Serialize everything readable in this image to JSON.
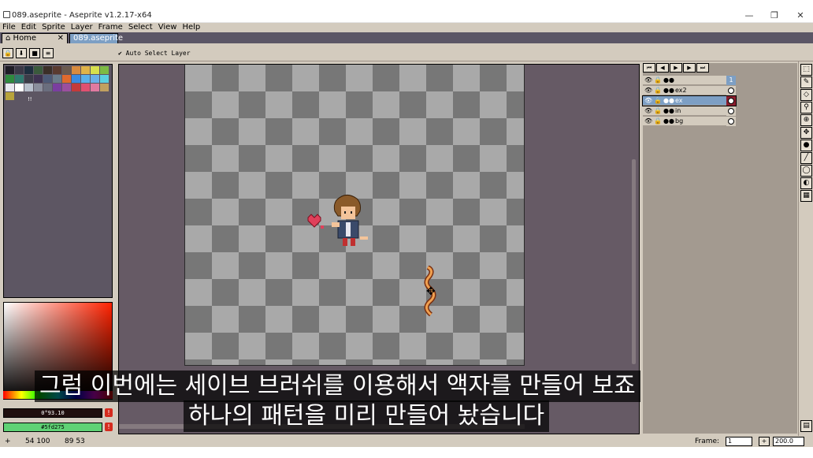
{
  "window": {
    "title": "089.aseprite - Aseprite v1.2.17-x64",
    "minimize": "—",
    "maximize": "❐",
    "close": "✕"
  },
  "menu": [
    "File",
    "Edit",
    "Sprite",
    "Layer",
    "Frame",
    "Select",
    "View",
    "Help"
  ],
  "tabs": [
    {
      "label": "Home",
      "icon": "home-icon"
    },
    {
      "label": "089.aseprite"
    }
  ],
  "context": {
    "auto_select": "Auto Select Layer"
  },
  "palette": {
    "colors": [
      "#1f1d27",
      "#3a3847",
      "#1e2f3f",
      "#3a5a3c",
      "#3b2f28",
      "#5a3b30",
      "#6b5a4f",
      "#d98b3e",
      "#e0b348",
      "#d8e04d",
      "#7dbb44",
      "#2e8a3e",
      "#2f7a6e",
      "#3b3c48",
      "#3f3352",
      "#4d5a77",
      "#6a7b8a",
      "#e06a2e",
      "#3a8ae0",
      "#5ab0ea",
      "#6bb0e8",
      "#5ad0e0",
      "#e8e8f0",
      "#ffffff",
      "#b8c0cc",
      "#8a8e9c",
      "#6a6e7e",
      "#7a3ea0",
      "#9b4f9f",
      "#c43a3a",
      "#e05070",
      "#e07aa0",
      "#c0a060",
      "#b8a43c"
    ],
    "marker": "!!"
  },
  "colors": {
    "foreground_value": "0°93.10",
    "background_value": "#5fd275",
    "foreground_color": "#1f0e0e",
    "background_color": "#5fd275"
  },
  "layers": [
    {
      "name": "",
      "selected": false
    },
    {
      "name": "ex2",
      "selected": false
    },
    {
      "name": "ex",
      "selected": true
    },
    {
      "name": "in",
      "selected": false
    },
    {
      "name": "bg",
      "selected": false
    }
  ],
  "frame_header": "1",
  "status": {
    "position": "54 100",
    "size": "89  53",
    "frame_label": "Frame:",
    "frame_value": "1",
    "zoom_value": "200.0"
  },
  "subtitles": {
    "line1": "그럼 이번에는 세이브 브러쉬를 이용해서 액자를 만들어 보죠",
    "line2": "하나의 패턴을 미리 만들어 놨습니다"
  }
}
